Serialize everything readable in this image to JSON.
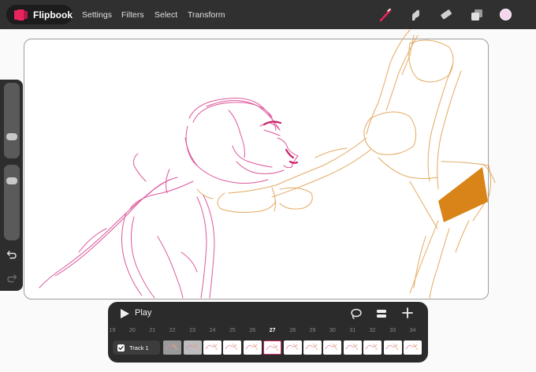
{
  "app": {
    "name": "Flipbook",
    "brand_color": "#e8245c"
  },
  "menu": {
    "settings": "Settings",
    "filters": "Filters",
    "select": "Select",
    "transform": "Transform"
  },
  "tools": [
    "brush-icon",
    "smudge-icon",
    "eraser-icon",
    "layers-icon"
  ],
  "current_color": "#f6d4ee",
  "sidebar": {
    "undo": "undo-icon",
    "redo": "redo-icon"
  },
  "timeline": {
    "play_label": "Play",
    "frame_numbers": [
      "19",
      "20",
      "21",
      "22",
      "23",
      "24",
      "25",
      "26",
      "27",
      "28",
      "29",
      "30",
      "31",
      "32",
      "33",
      "34"
    ],
    "current_frame": "27",
    "track_label": "Track 1"
  },
  "colors": {
    "ink_magenta": "#d63a8a",
    "ink_orange": "#e0a050",
    "fill_orange": "#d98418"
  }
}
